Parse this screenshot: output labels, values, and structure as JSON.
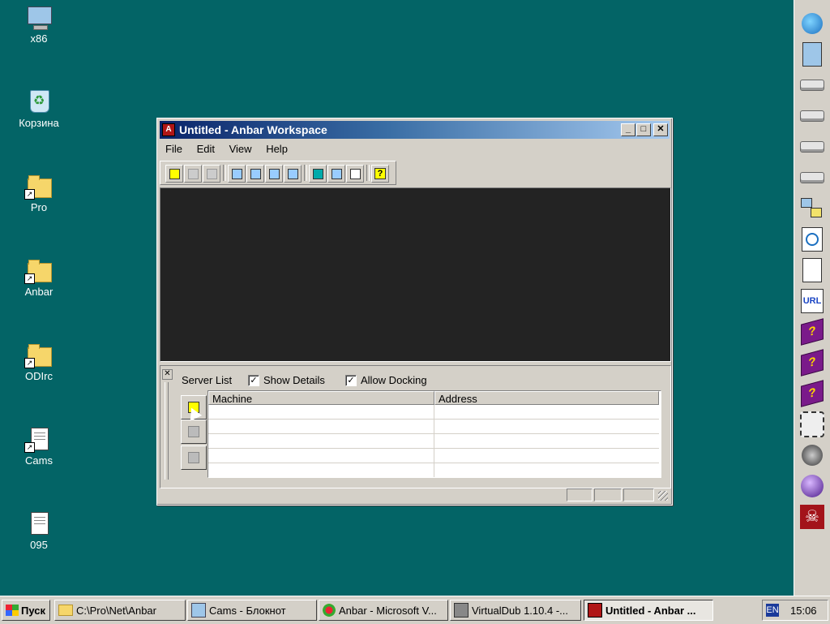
{
  "desktop": {
    "icons": [
      {
        "label": "x86",
        "icon": "computer-icon"
      },
      {
        "label": "Корзина",
        "icon": "recycle-bin-icon"
      },
      {
        "label": "Pro",
        "icon": "folder-shortcut-icon"
      },
      {
        "label": "Anbar",
        "icon": "folder-shortcut-icon"
      },
      {
        "label": "ODIrc",
        "icon": "folder-shortcut-icon"
      },
      {
        "label": "Cams",
        "icon": "text-file-shortcut-icon"
      },
      {
        "label": "095",
        "icon": "text-file-icon"
      }
    ]
  },
  "window": {
    "title": "Untitled - Anbar Workspace",
    "app_icon_letter": "A",
    "controls": {
      "minimize": "_",
      "maximize": "□",
      "close": "✕"
    },
    "menu": [
      "File",
      "Edit",
      "View",
      "Help"
    ],
    "toolbar_help": "?",
    "panel": {
      "close_glyph": "✕",
      "server_list_label": "Server List",
      "show_details_label": "Show Details",
      "show_details_checked": true,
      "allow_docking_label": "Allow Docking",
      "allow_docking_checked": true,
      "check_glyph": "✓",
      "columns": [
        "Machine",
        "Address"
      ],
      "rows": [
        [
          "",
          ""
        ],
        [
          "",
          ""
        ],
        [
          "",
          ""
        ],
        [
          "",
          ""
        ],
        [
          "",
          ""
        ]
      ]
    }
  },
  "sidebar": {
    "items": [
      "globe-icon",
      "binder-icon",
      "drive-icon",
      "drive-icon",
      "drive-icon",
      "drive-icon",
      "network-icon",
      "search-file-icon",
      "text-file-icon",
      "url-file-icon",
      "help-book-icon",
      "help-book-icon",
      "help-book-icon",
      "gear-icon",
      "speaker-icon",
      "sphere-icon",
      "skull-icon"
    ],
    "url_text": "URL",
    "help_glyph": "?",
    "skull_glyph": "☠"
  },
  "taskbar": {
    "start_label": "Пуск",
    "tasks": [
      {
        "label": "C:\\Pro\\Net\\Anbar",
        "active": false
      },
      {
        "label": "Cams - Блокнот",
        "active": false
      },
      {
        "label": "Anbar - Microsoft V...",
        "active": false
      },
      {
        "label": "VirtualDub 1.10.4 -...",
        "active": false
      },
      {
        "label": "Untitled - Anbar ...",
        "active": true
      }
    ],
    "lang": "EN",
    "clock": "15:06"
  },
  "colors": {
    "desktop": "#036466",
    "workspace": "#232323",
    "titlebar_start": "#0a246a",
    "titlebar_end": "#a6caf0"
  }
}
